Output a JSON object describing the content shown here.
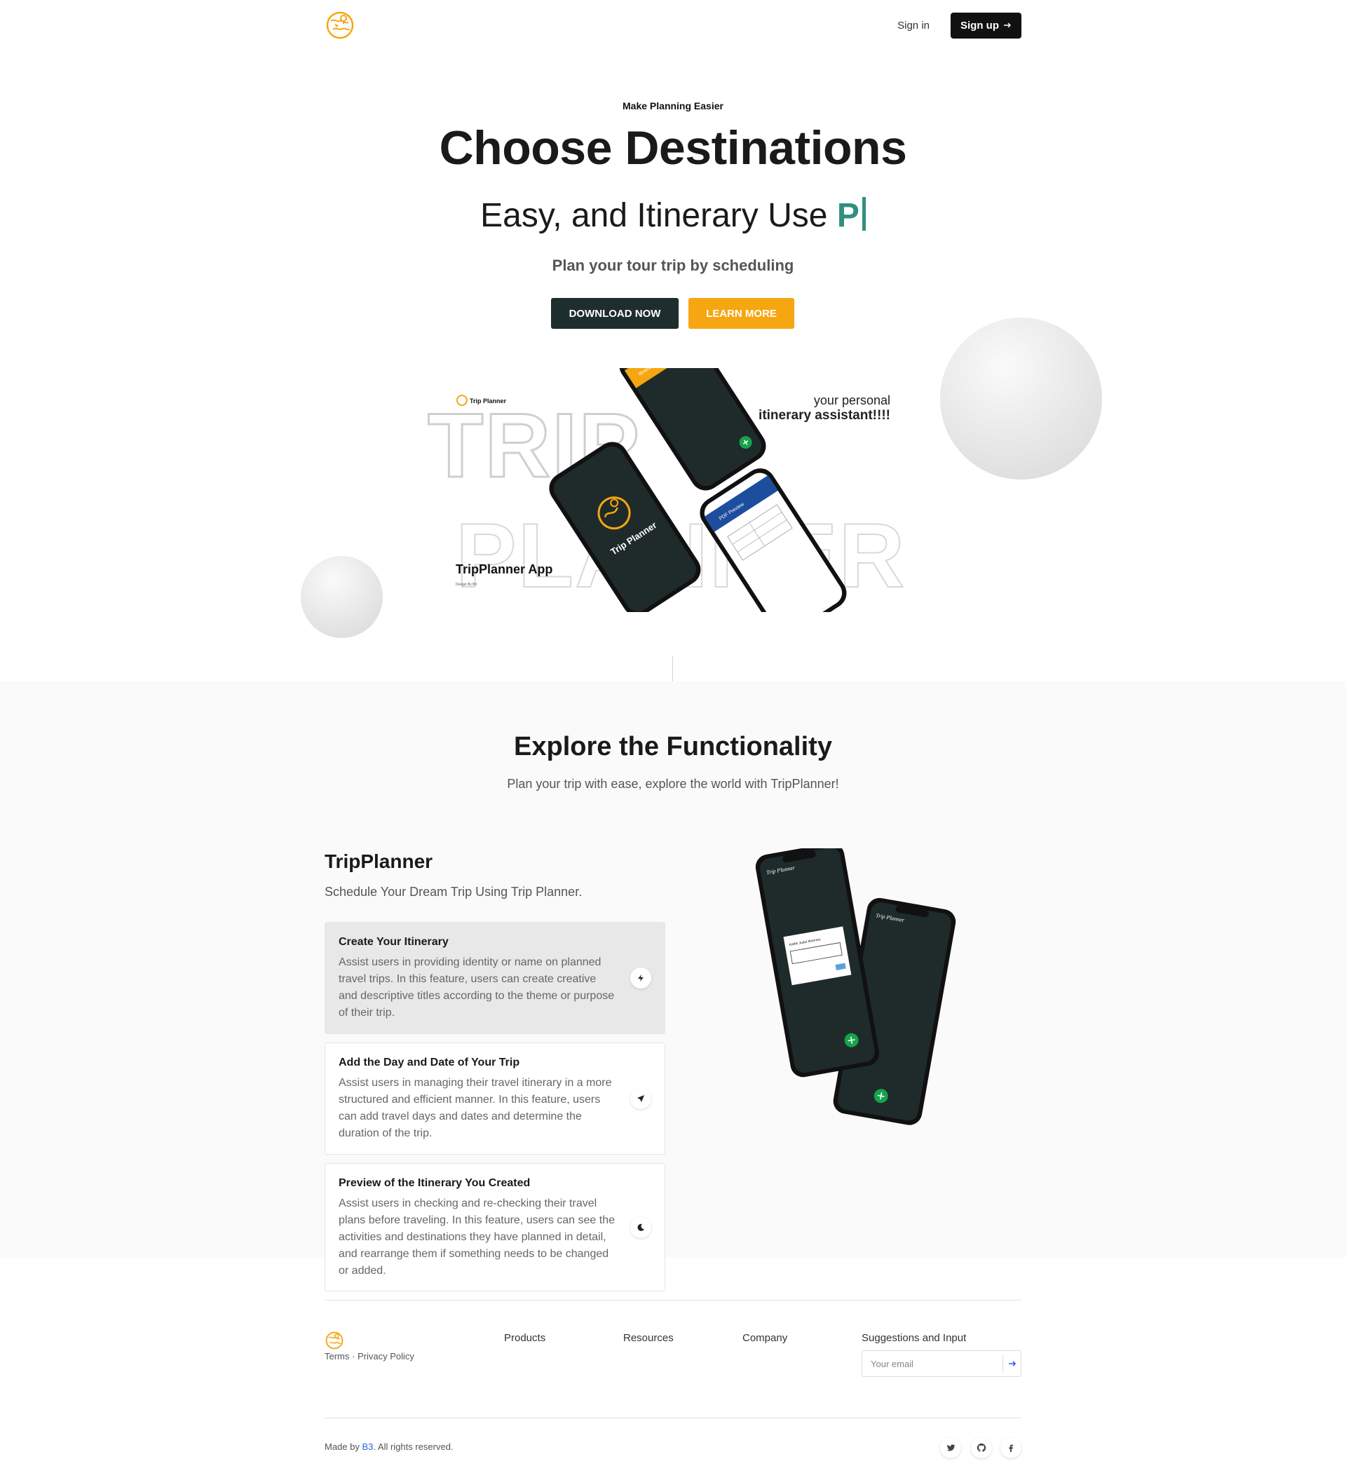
{
  "header": {
    "sign_in": "Sign in",
    "sign_up": "Sign up"
  },
  "hero": {
    "eyebrow": "Make Planning Easier",
    "title": "Choose Destinations",
    "subtitle": "Easy, and Itinerary Use",
    "typed": "P",
    "description": "Plan your tour trip by scheduling",
    "download_button": "DOWNLOAD NOW",
    "learn_button": "LEARN MORE"
  },
  "hero_image": {
    "logo_text": "Trip Planner",
    "bg_word_1": "TRIP",
    "bg_word_2": "PLANNER",
    "tagline_1": "your personal",
    "tagline_2": "itinerary assistant!!!!",
    "app_name": "TripPlanner App",
    "credit": "Design By B3",
    "phone_brand": "Trip Planner",
    "pdf_header": "PDF Preview",
    "itinerary_label": "Itinerary to Bali"
  },
  "features": {
    "title": "Explore the Functionality",
    "subtitle": "Plan your trip with ease, explore the world with TripPlanner!",
    "app_title": "TripPlanner",
    "app_subtitle": "Schedule Your Dream Trip Using Trip Planner.",
    "cards": [
      {
        "title": "Create Your Itinerary",
        "text": "Assist users in providing identity or name on planned travel trips. In this feature, users can create creative and descriptive titles according to the theme or purpose of their trip.",
        "icon": "lightning-icon"
      },
      {
        "title": "Add the Day and Date of Your Trip",
        "text": "Assist users in managing their travel itinerary in a more structured and efficient manner. In this feature, users can add travel days and dates and determine the duration of the trip.",
        "icon": "send-icon"
      },
      {
        "title": "Preview of the Itinerary You Created",
        "text": "Assist users in checking and re-checking their travel plans before traveling. In this feature, users can see the activities and destinations they have planned in detail, and rearrange them if something needs to be changed or added.",
        "icon": "moon-icon"
      }
    ],
    "phone_brand": "Trip Planner",
    "dialog_text": "Kathk Judul Itinerary"
  },
  "footer": {
    "terms": "Terms",
    "separator": "·",
    "privacy": "Privacy Policy",
    "columns": [
      "Products",
      "Resources",
      "Company",
      "Suggestions and Input"
    ],
    "email_placeholder": "Your email",
    "made_by_prefix": "Made by ",
    "made_by_link": "B3",
    "made_by_suffix": ". All rights reserved.",
    "social_icons": [
      "twitter-icon",
      "github-icon",
      "facebook-icon"
    ]
  },
  "colors": {
    "brand_orange": "#f6a611",
    "dark_teal": "#1e2d2d",
    "accent_teal": "#2f8f82",
    "link_blue": "#2563eb"
  }
}
